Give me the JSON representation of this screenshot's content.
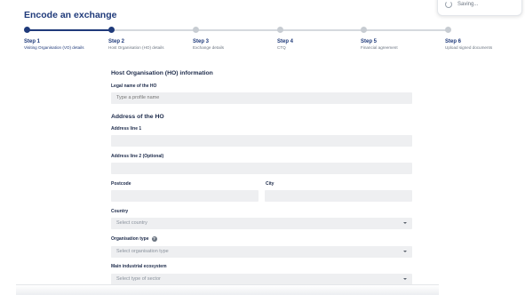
{
  "toast": {
    "text": "Saving..."
  },
  "page": {
    "title": "Encode an exchange"
  },
  "steps": [
    {
      "label": "Step 1",
      "desc": "Visiting Organisation (VO) details"
    },
    {
      "label": "Step 2",
      "desc": "Host Organisation (HO) details"
    },
    {
      "label": "Step 3",
      "desc": "Exchange details"
    },
    {
      "label": "Step 4",
      "desc": "CTQ"
    },
    {
      "label": "Step 5",
      "desc": "Financial agreement"
    },
    {
      "label": "Step 6",
      "desc": "Upload signed documents"
    }
  ],
  "form": {
    "section_title": "Host Organisation (HO) information",
    "legal_name_label": "Legal name of the HO",
    "legal_name_placeholder": "Type a profile name",
    "address_title": "Address of the HO",
    "address1_label": "Address line 1",
    "address2_label": "Address line 2  (Optional)",
    "postcode_label": "Postcode",
    "city_label": "City",
    "country_label": "Country",
    "country_placeholder": "Select country",
    "org_type_label": "Organisation type",
    "org_type_placeholder": "Select organisation type",
    "ecosystem_label": "Main industrial ecosystem",
    "ecosystem_placeholder": "Select type of sector"
  },
  "colors": {
    "accent": "#1f3a7a",
    "field_bg": "#eeeff1",
    "pending": "#c7ccd2"
  }
}
